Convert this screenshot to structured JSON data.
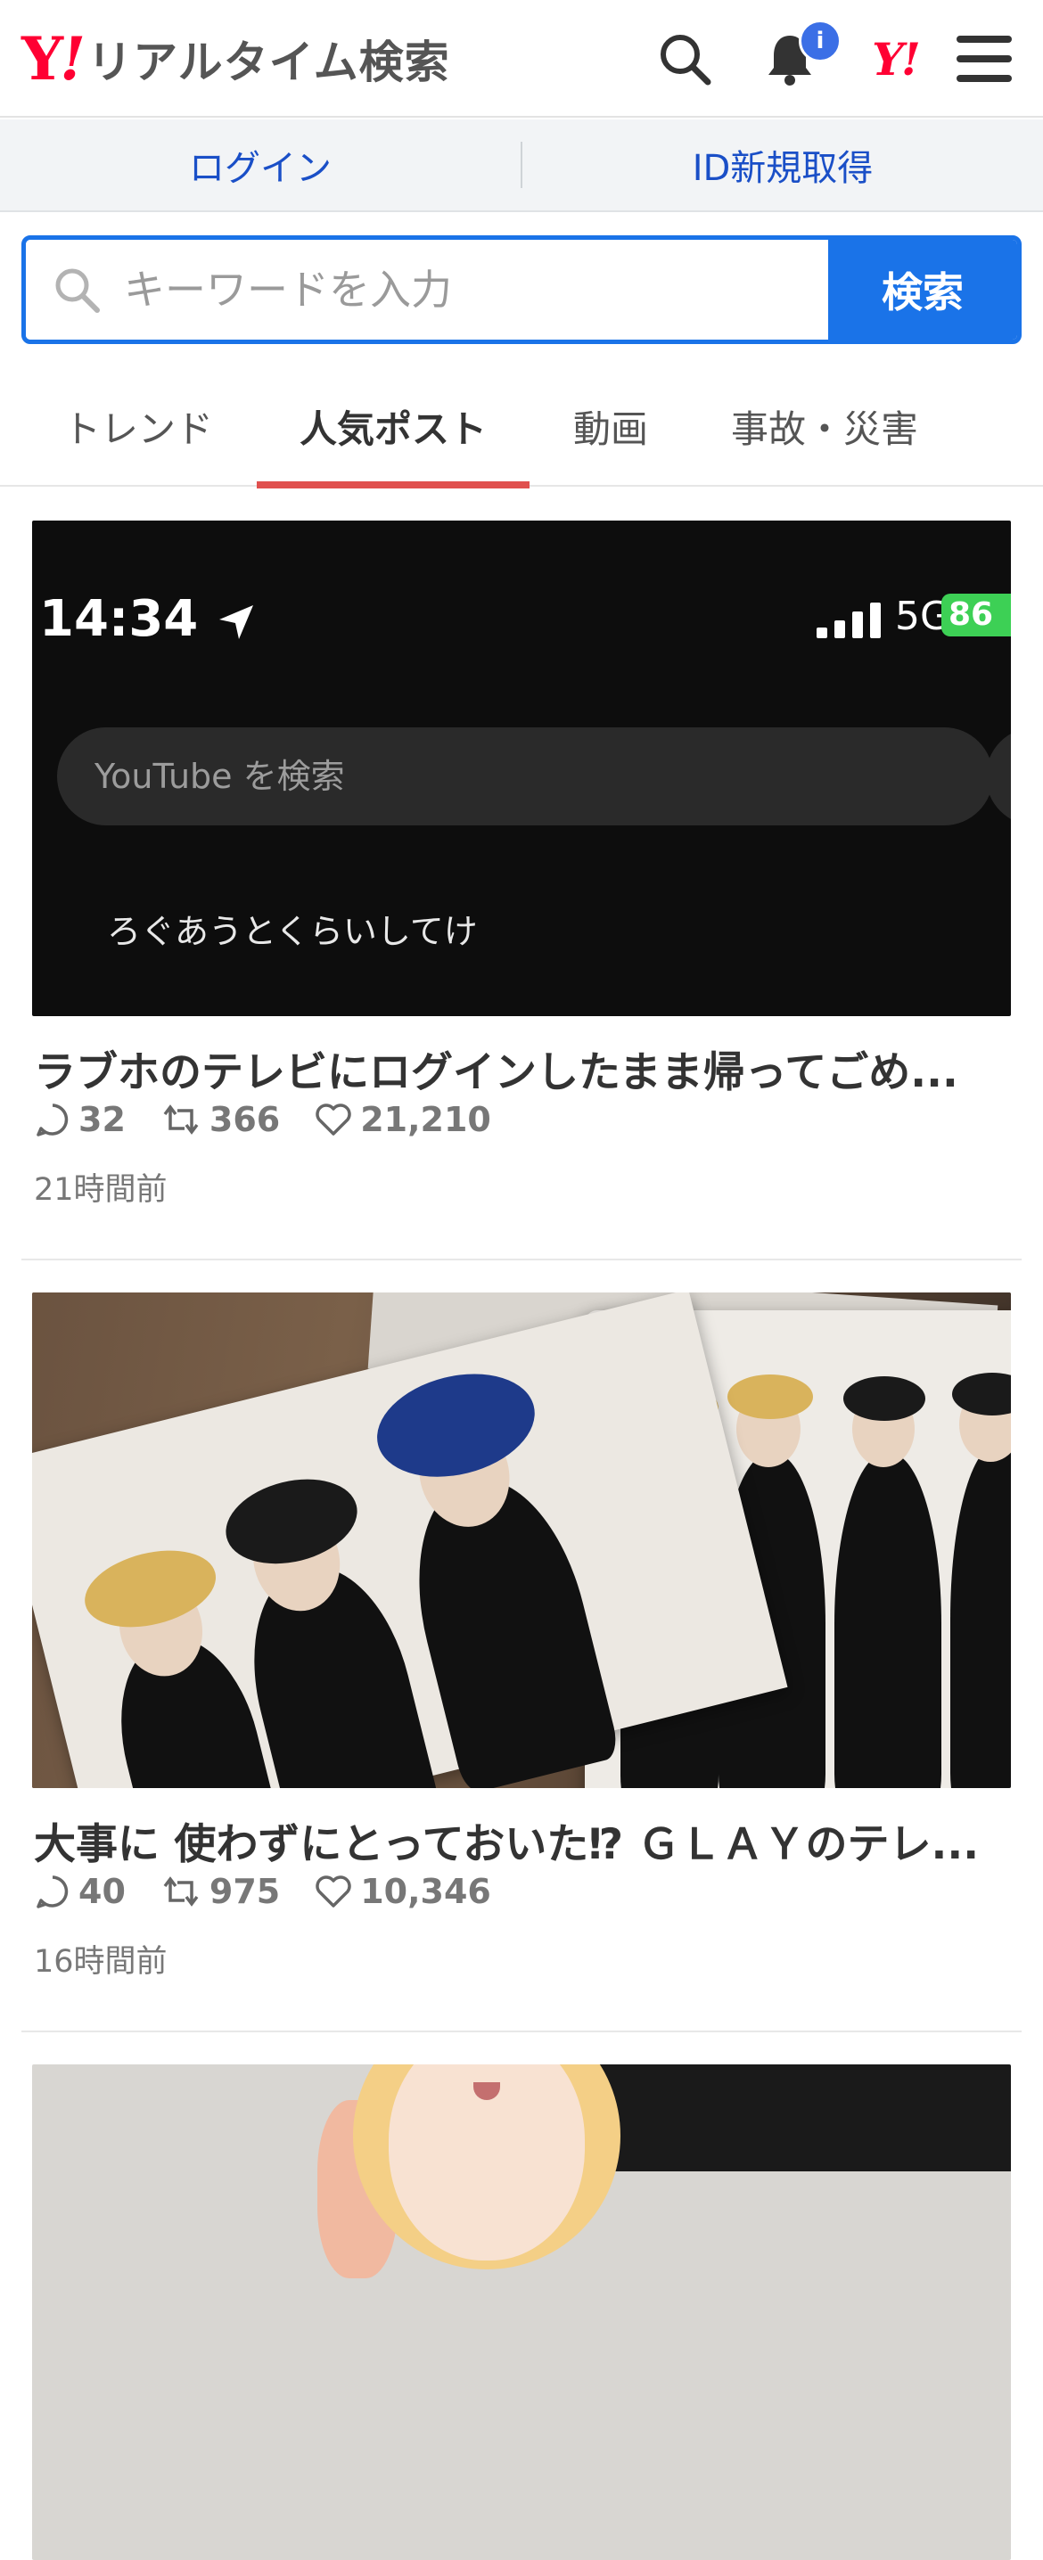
{
  "header": {
    "logo_y": "Y",
    "logo_bang": "!",
    "logo_text": "リアルタイム検索",
    "notification_badge": "i",
    "yahoo_mini_y": "Y",
    "yahoo_mini_bang": "!"
  },
  "login_bar": {
    "login": "ログイン",
    "register": "ID新規取得"
  },
  "search": {
    "placeholder": "キーワードを入力",
    "button": "検索"
  },
  "tabs": [
    {
      "label": "トレンド",
      "active": false
    },
    {
      "label": "人気ポスト",
      "active": true
    },
    {
      "label": "動画",
      "active": false
    },
    {
      "label": "事故・災害",
      "active": false
    }
  ],
  "posts": [
    {
      "title": "ラブホのテレビにログインしたまま帰ってごめ...",
      "replies": "32",
      "reposts": "366",
      "likes": "21,210",
      "time": "21時間前",
      "media": {
        "status_time": "14:34",
        "network": "5G",
        "battery": "86",
        "search_placeholder": "YouTube を検索",
        "suggestion": "ろぐあうとくらいしてけ"
      }
    },
    {
      "title": "大事に 使わずにとっておいた⁉ ＧＬＡＹのテレ...",
      "replies": "40",
      "reposts": "975",
      "likes": "10,346",
      "time": "16時間前"
    }
  ],
  "colors": {
    "brand_red": "#ff0033",
    "link_blue": "#1a4fc7",
    "search_blue": "#1a73e8",
    "tab_indicator": "#e0504e",
    "badge_blue": "#3b6fe6"
  },
  "icons": [
    "search-icon",
    "bell-icon",
    "yahoo-logo-icon",
    "menu-icon",
    "reply-icon",
    "repost-icon",
    "like-icon"
  ]
}
